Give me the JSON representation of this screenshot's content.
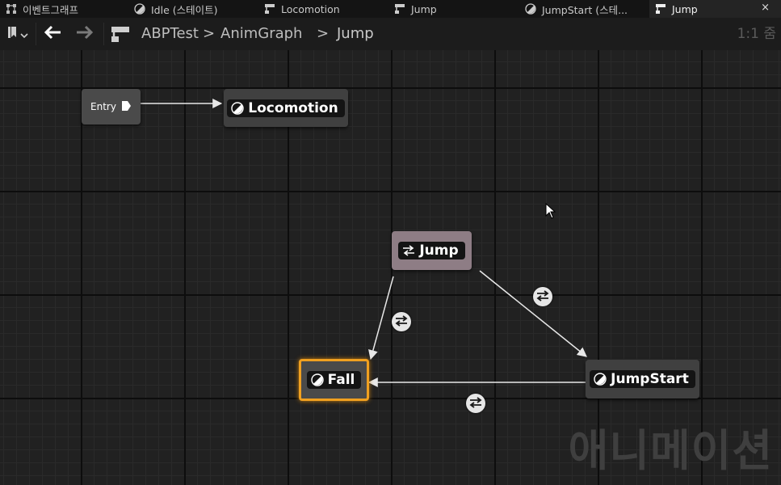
{
  "tabs": [
    {
      "label": "이벤트그래프",
      "icon": "event-graph-icon"
    },
    {
      "label": "Idle (스테이트)",
      "icon": "state-icon"
    },
    {
      "label": "Locomotion",
      "icon": "state-machine-icon"
    },
    {
      "label": "Jump",
      "icon": "state-machine-icon"
    },
    {
      "label": "JumpStart (스테...",
      "icon": "state-icon"
    },
    {
      "label": "Jump",
      "icon": "state-machine-icon",
      "active": true,
      "close": "×"
    }
  ],
  "toolbar": {
    "breadcrumb": [
      "ABPTest",
      "AnimGraph",
      "Jump"
    ],
    "separators": [
      ">",
      ">"
    ],
    "zoom": "1:1 줌"
  },
  "graph": {
    "entry_label": "Entry",
    "nodes": {
      "locomotion": "Locomotion",
      "jump": "Jump",
      "fall": "Fall",
      "jumpstart": "JumpStart"
    },
    "watermark": "애니메이션"
  },
  "colors": {
    "accent_selected": "#f0a020",
    "conduit": "#8e7d85",
    "state_node": "#404040",
    "wire": "#e8e8e8"
  }
}
